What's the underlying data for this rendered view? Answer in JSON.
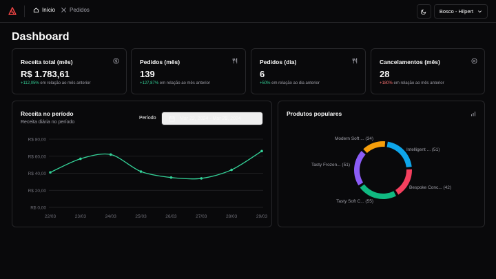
{
  "nav": {
    "home_label": "Início",
    "orders_label": "Pedidos",
    "account_label": "Bosco - Hilpert"
  },
  "page": {
    "title": "Dashboard"
  },
  "cards": [
    {
      "title": "Receita total (mês)",
      "value": "R$ 1.783,61",
      "delta": "+112,05%",
      "delta_text": " em relação ao mês anterior",
      "icon": "dollar-circle-icon"
    },
    {
      "title": "Pedidos (mês)",
      "value": "139",
      "delta": "+127,87%",
      "delta_text": " em relação ao mês anterior",
      "icon": "utensils-icon"
    },
    {
      "title": "Pedidos (dia)",
      "value": "6",
      "delta": "+50%",
      "delta_text": " em relação ao dia anterior",
      "icon": "utensils-icon"
    },
    {
      "title": "Cancelamentos (mês)",
      "value": "28",
      "delta": "+180%",
      "delta_text": " em relação ao mês anterior",
      "icon": "x-circle-icon"
    }
  ],
  "revenue_panel": {
    "title": "Receita no período",
    "subtitle": "Receita diária no período",
    "period_label": "Período",
    "date_range": "Mar 22, 2024 - Mar 29, 2024"
  },
  "popular_panel": {
    "title": "Produtos populares"
  },
  "colors": {
    "line": "#34d399",
    "donut": [
      "#0ea5e9",
      "#f43f5e",
      "#10b981",
      "#8b5cf6",
      "#f59e0b"
    ]
  },
  "chart_data": [
    {
      "type": "line",
      "categories": [
        "22/03",
        "23/03",
        "24/03",
        "25/03",
        "26/03",
        "27/03",
        "28/03",
        "29/03"
      ],
      "values": [
        41,
        57,
        62,
        42,
        35,
        34,
        44,
        66
      ],
      "y_ticks": [
        "R$ 0,00",
        "R$ 20,00",
        "R$ 40,00",
        "R$ 60,00",
        "R$ 80,00"
      ],
      "ylim": [
        0,
        80
      ],
      "grid": true
    },
    {
      "type": "pie",
      "labels": [
        "Intelligent ... (51)",
        "Bespoke Conc... (42)",
        "Tasty Soft C... (55)",
        "Tasty Frozen... (51)",
        "Modern Soft ... (34)"
      ],
      "values": [
        51,
        42,
        55,
        51,
        34
      ]
    }
  ]
}
